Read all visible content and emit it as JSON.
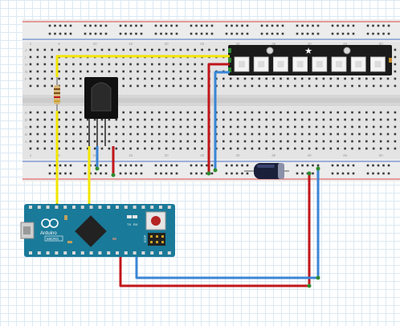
{
  "breadboard": {
    "column_numbers": [
      "1",
      "5",
      "10",
      "15",
      "20",
      "25",
      "30",
      "35",
      "40",
      "45",
      "50"
    ],
    "row_letters_top": [
      "J",
      "I",
      "H",
      "G",
      "F"
    ],
    "row_letters_bottom": [
      "E",
      "D",
      "C",
      "B",
      "A"
    ]
  },
  "arduino": {
    "brand": "Arduino",
    "model": "MICRO",
    "tx_label": "TX",
    "rx_label": "RX",
    "icsp_label": "ICSP"
  },
  "components": {
    "ir_receiver": "IR receiver",
    "resistor": "resistor",
    "capacitor": "capacitor",
    "led_strip": "NeoPixel stick",
    "led_count": 8
  },
  "colors": {
    "wire_yellow": "#f2e500",
    "wire_red": "#c0161b",
    "wire_blue": "#3a85d6",
    "rail_red": "#e04848",
    "rail_blue": "#4a73c8",
    "board_blue": "#1a7a99",
    "breadboard": "#e5e5e5"
  }
}
